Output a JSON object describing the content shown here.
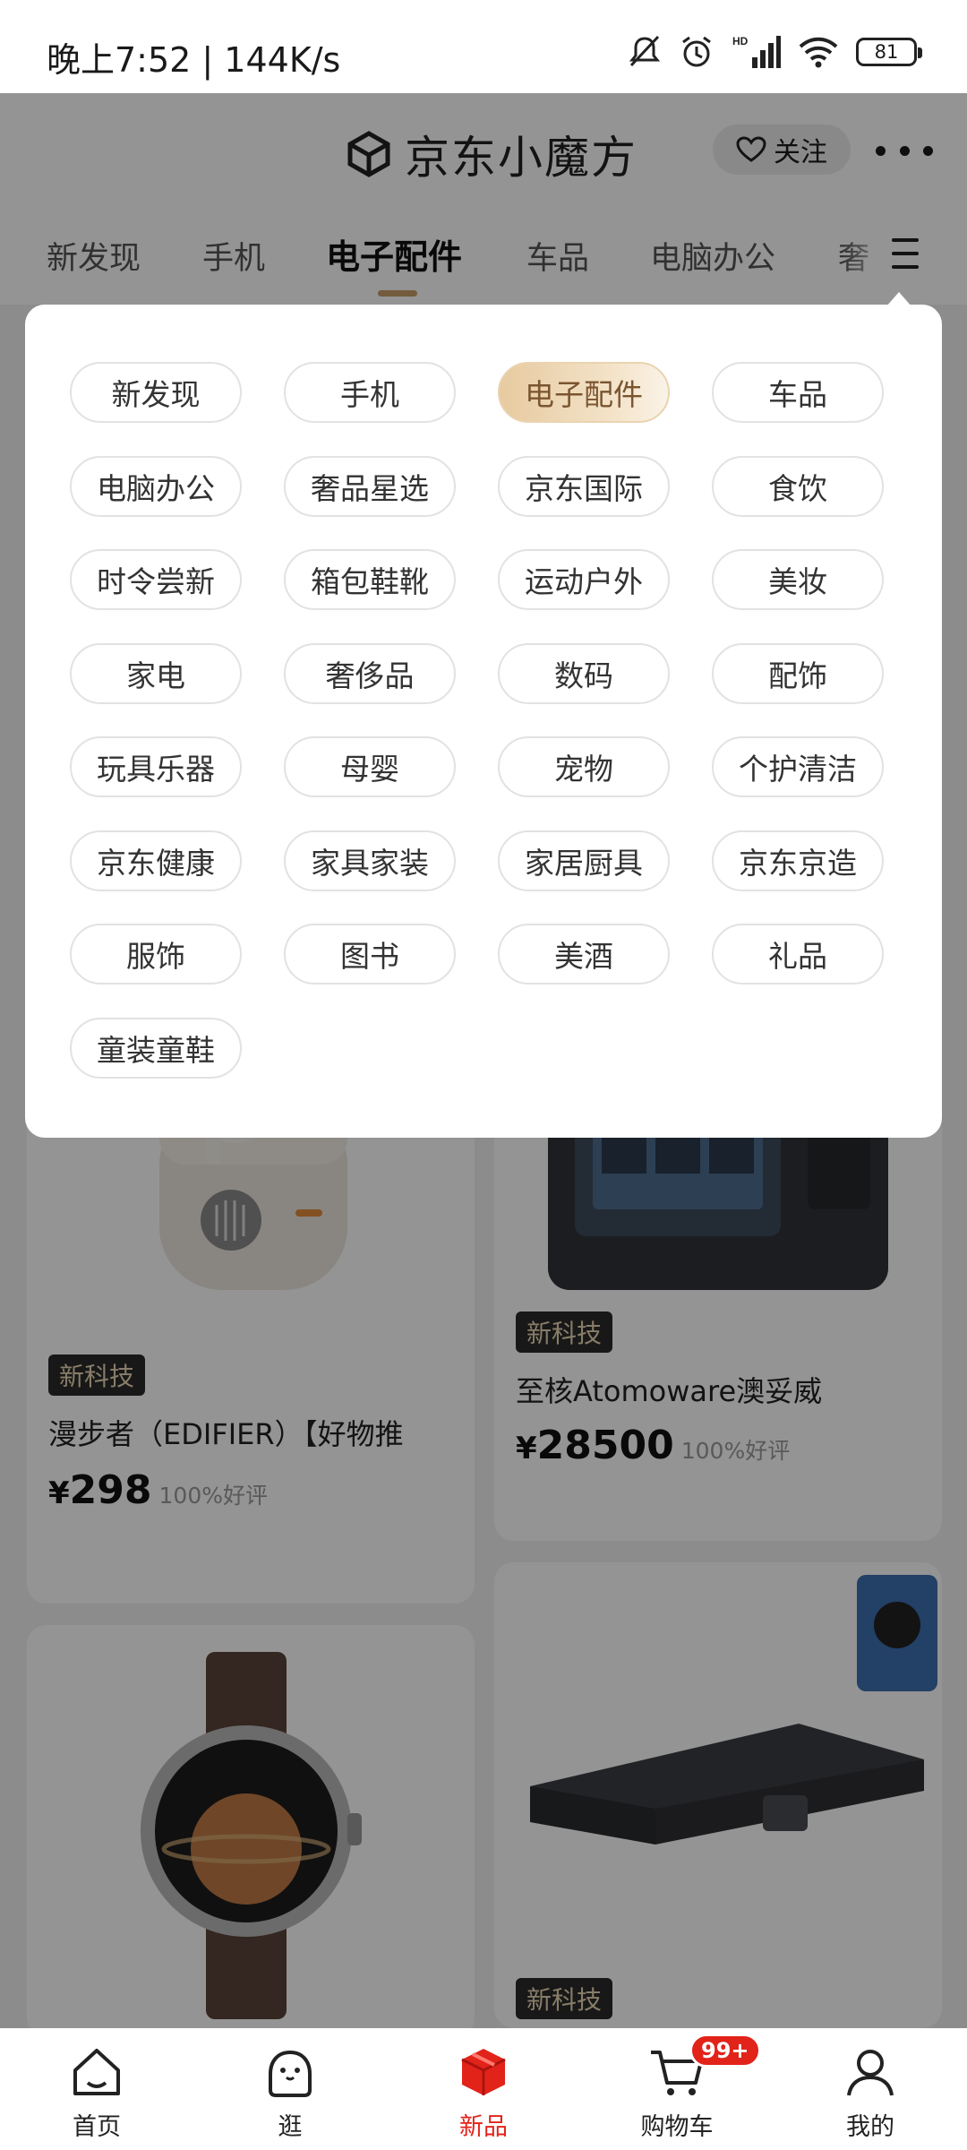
{
  "status": {
    "time": "晚上7:52 | 144K/s",
    "battery": "81",
    "signal_label": "HD"
  },
  "header": {
    "logo_text": "京东小魔方",
    "follow_label": "关注"
  },
  "tabs": [
    {
      "label": "新发现"
    },
    {
      "label": "手机"
    },
    {
      "label": "电子配件",
      "active": true
    },
    {
      "label": "车品"
    },
    {
      "label": "电脑办公"
    },
    {
      "label": "奢"
    }
  ],
  "categories": [
    "新发现",
    "手机",
    "电子配件",
    "车品",
    "电脑办公",
    "奢品星选",
    "京东国际",
    "食饮",
    "时令尝新",
    "箱包鞋靴",
    "运动户外",
    "美妆",
    "家电",
    "奢侈品",
    "数码",
    "配饰",
    "玩具乐器",
    "母婴",
    "宠物",
    "个护清洁",
    "京东健康",
    "家具家装",
    "家居厨具",
    "京东京造",
    "服饰",
    "图书",
    "美酒",
    "礼品",
    "童装童鞋"
  ],
  "selected_category": "电子配件",
  "products": [
    {
      "tag": "新科技",
      "title": "漫步者（EDIFIER）【好物推",
      "price_symbol": "¥",
      "price": "298",
      "rating": "100%好评"
    },
    {
      "tag": "新科技",
      "title": "至核Atomoware澳妥威",
      "price_symbol": "¥",
      "price": "28500",
      "rating": "100%好评"
    },
    {
      "tag": "新科技",
      "title": ""
    }
  ],
  "bottom_nav": {
    "items": [
      {
        "label": "首页",
        "icon": "home-icon"
      },
      {
        "label": "逛",
        "icon": "browse-icon"
      },
      {
        "label": "新品",
        "icon": "new-product-icon",
        "active": true
      },
      {
        "label": "购物车",
        "icon": "cart-icon",
        "badge": "99+"
      },
      {
        "label": "我的",
        "icon": "profile-icon"
      }
    ]
  },
  "colors": {
    "accent": "#e2231a",
    "chip_selected": "#e7caa0",
    "tag_bg": "#2a2a2a",
    "tab_underline": "#c89d6a"
  }
}
